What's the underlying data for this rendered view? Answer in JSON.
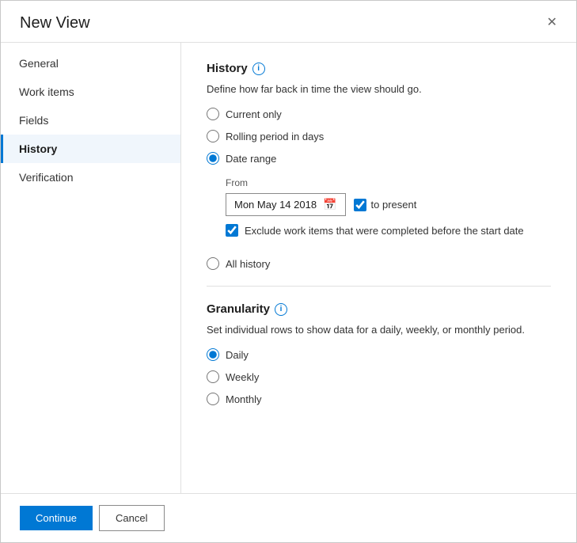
{
  "dialog": {
    "title": "New View",
    "close_label": "✕"
  },
  "sidebar": {
    "items": [
      {
        "id": "general",
        "label": "General",
        "active": false
      },
      {
        "id": "work-items",
        "label": "Work items",
        "active": false
      },
      {
        "id": "fields",
        "label": "Fields",
        "active": false
      },
      {
        "id": "history",
        "label": "History",
        "active": true
      },
      {
        "id": "verification",
        "label": "Verification",
        "active": false
      }
    ]
  },
  "content": {
    "history_section": {
      "title": "History",
      "description": "Define how far back in time the view should go.",
      "options": [
        {
          "id": "current-only",
          "label": "Current only",
          "checked": false
        },
        {
          "id": "rolling-period",
          "label": "Rolling period in days",
          "checked": false
        },
        {
          "id": "date-range",
          "label": "Date range",
          "checked": true
        },
        {
          "id": "all-history",
          "label": "All history",
          "checked": false
        }
      ],
      "from_label": "From",
      "date_value": "Mon May 14 2018",
      "to_present_label": "to present",
      "exclude_label": "Exclude work items that were completed before the start date"
    },
    "granularity_section": {
      "title": "Granularity",
      "description": "Set individual rows to show data for a daily, weekly, or monthly period.",
      "options": [
        {
          "id": "daily",
          "label": "Daily",
          "checked": true
        },
        {
          "id": "weekly",
          "label": "Weekly",
          "checked": false
        },
        {
          "id": "monthly",
          "label": "Monthly",
          "checked": false
        }
      ]
    }
  },
  "footer": {
    "continue_label": "Continue",
    "cancel_label": "Cancel"
  }
}
